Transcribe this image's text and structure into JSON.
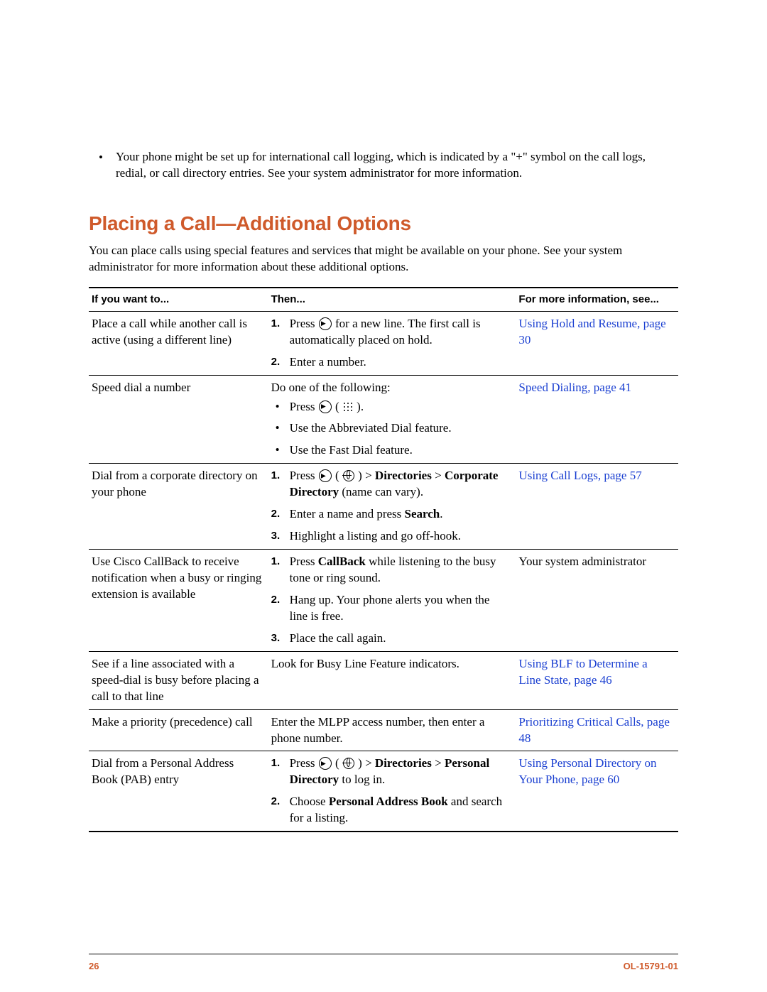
{
  "top_bullet": "Your phone might be set up for international call logging, which is indicated by a \"+\" symbol on the call logs, redial, or call directory entries. See your system administrator for more information.",
  "heading": "Placing a Call—Additional Options",
  "intro": "You can place calls using special features and services that might be available on your phone. See your system administrator for more information about these additional options.",
  "table": {
    "headers": {
      "col1": "If you want to...",
      "col2": "Then...",
      "col3": "For more information, see..."
    },
    "rows": [
      {
        "want": "Place a call while another call is active (using a different line)",
        "then_type": "numbered_icons_1",
        "then": {
          "s1a": "Press ",
          "s1b": " for a new line. The first call is automatically placed on hold.",
          "s2": "Enter a number."
        },
        "info_link": "Using Hold and Resume, page 30"
      },
      {
        "want": "Speed dial a number",
        "then_type": "do_following",
        "then": {
          "lead": "Do one of the following:",
          "b1a": "Press ",
          "b1b": " ( ",
          "b1c": " ).",
          "b2": "Use the Abbreviated Dial feature.",
          "b3": "Use the Fast Dial feature."
        },
        "info_link": "Speed Dialing, page 41"
      },
      {
        "want": "Dial from a corporate directory on your phone",
        "then_type": "numbered_dir_corp",
        "then": {
          "s1a": "Press ",
          "s1b": " ( ",
          "s1c": " ) > ",
          "s1d": "Directories",
          "s1e": " > ",
          "s1f": "Corporate Directory",
          "s1g": " (name can vary).",
          "s2a": "Enter a name and press ",
          "s2b": "Search",
          "s2c": ".",
          "s3": "Highlight a listing and go off-hook."
        },
        "info_link": "Using Call Logs, page 57"
      },
      {
        "want": "Use Cisco CallBack to receive notification when a busy or ringing extension is available",
        "then_type": "numbered_callback",
        "then": {
          "s1a": "Press ",
          "s1b": "CallBack",
          "s1c": " while listening to the busy tone or ring sound.",
          "s2": "Hang up. Your phone alerts you when the line is free.",
          "s3": "Place the call again."
        },
        "info_text": "Your system administrator"
      },
      {
        "want": "See if a line associated with a speed-dial is busy before placing a call to that line",
        "then_type": "plain",
        "then": {
          "text": "Look for Busy Line Feature indicators."
        },
        "info_link": "Using BLF to Determine a Line State, page 46"
      },
      {
        "want": "Make a priority (precedence) call",
        "then_type": "plain",
        "then": {
          "text": "Enter the MLPP access number, then enter a phone number."
        },
        "info_link": "Prioritizing Critical Calls, page 48"
      },
      {
        "want": "Dial from a Personal Address Book (PAB) entry",
        "then_type": "numbered_dir_pers",
        "then": {
          "s1a": "Press ",
          "s1b": " ( ",
          "s1c": " ) > ",
          "s1d": "Directories",
          "s1e": " > ",
          "s1f": "Personal Directory",
          "s1g": " to log in.",
          "s2a": "Choose ",
          "s2b": "Personal Address Book",
          "s2c": " and search for a listing."
        },
        "info_link": "Using Personal Directory on Your Phone, page 60"
      }
    ]
  },
  "footer": {
    "page": "26",
    "docid": "OL-15791-01"
  }
}
